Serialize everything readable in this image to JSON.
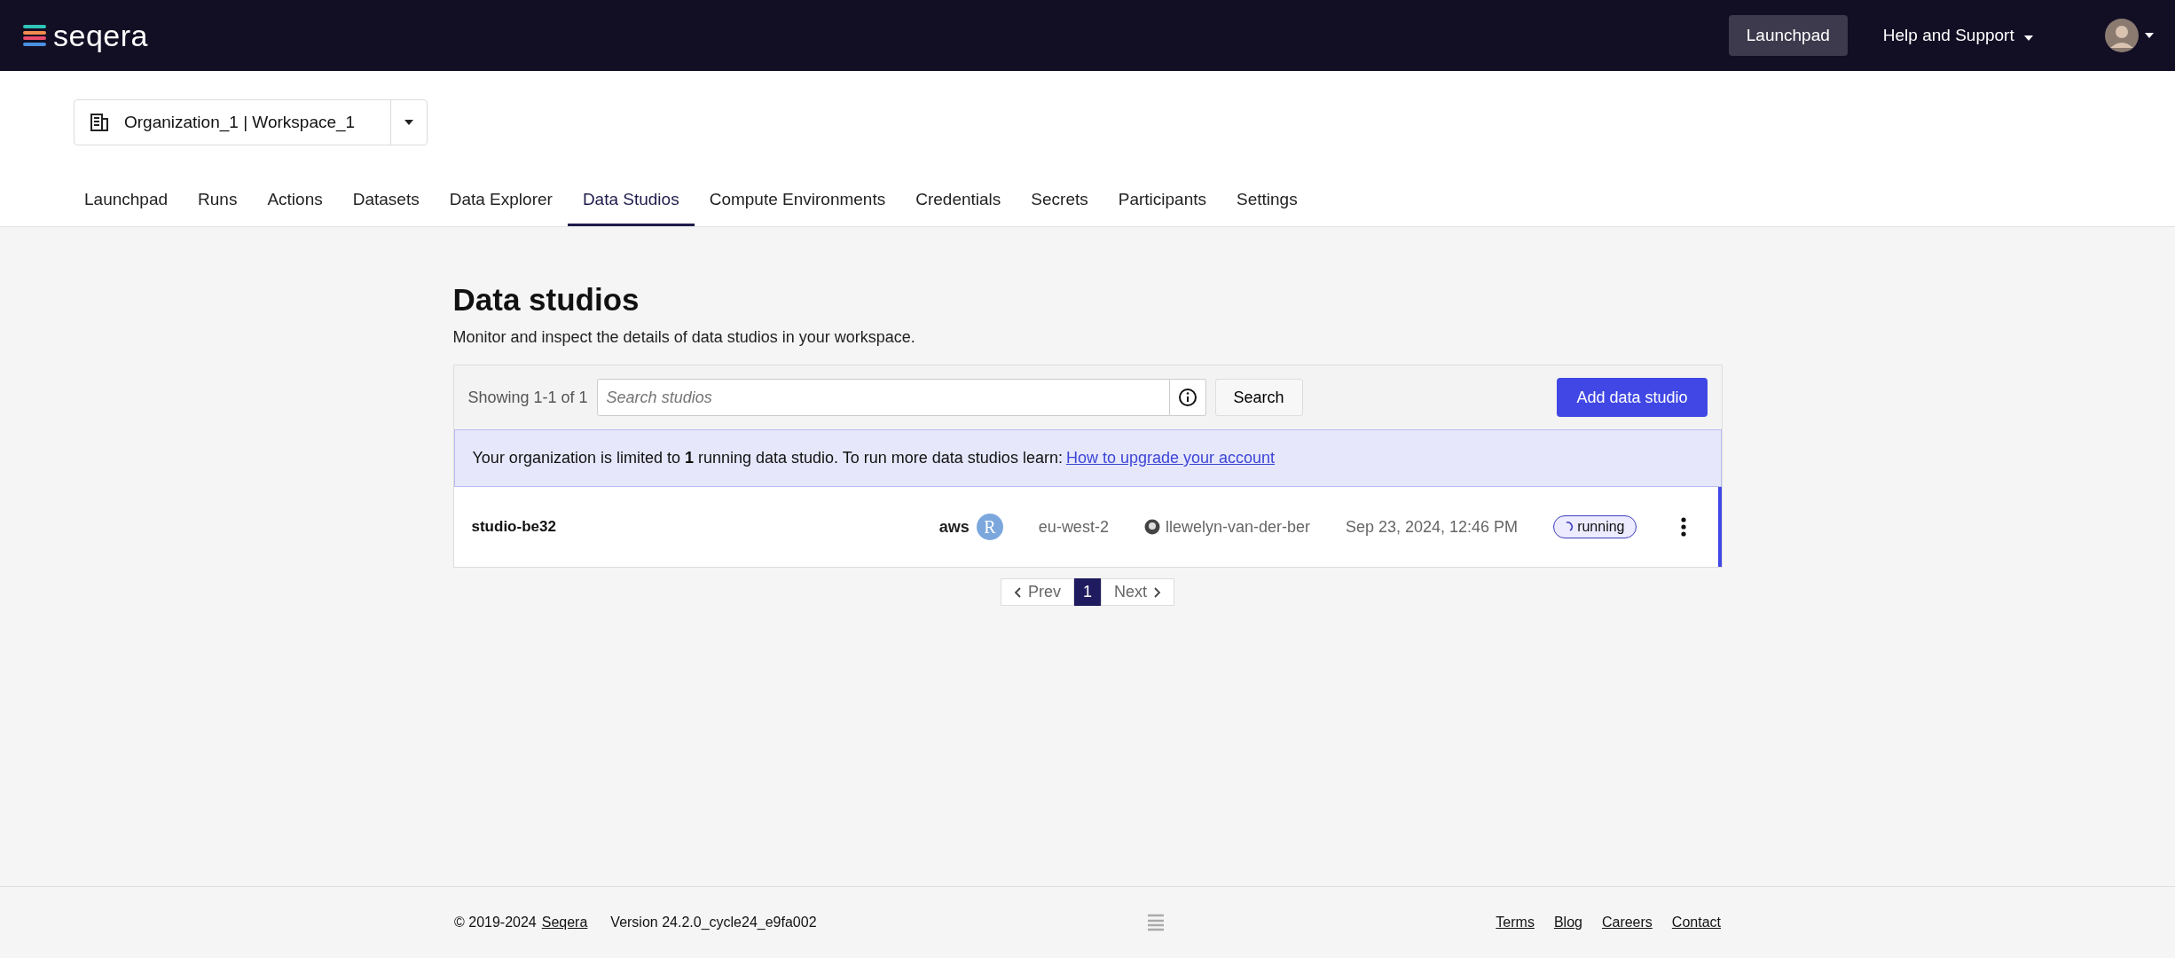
{
  "header": {
    "logo": "seqera",
    "buttons": [
      {
        "label": "Launchpad",
        "kind": "button"
      },
      {
        "label": "Help and Support",
        "kind": "dropdown"
      }
    ]
  },
  "workspace_selector": {
    "value": "Organization_1 | Workspace_1"
  },
  "tabs": [
    {
      "label": "Launchpad",
      "selected": false
    },
    {
      "label": "Runs",
      "selected": false
    },
    {
      "label": "Actions",
      "selected": false
    },
    {
      "label": "Datasets",
      "selected": false
    },
    {
      "label": "Data Explorer",
      "selected": false
    },
    {
      "label": "Data Studios",
      "selected": true
    },
    {
      "label": "Compute Environments",
      "selected": false
    },
    {
      "label": "Credentials",
      "selected": false
    },
    {
      "label": "Secrets",
      "selected": false
    },
    {
      "label": "Participants",
      "selected": false
    },
    {
      "label": "Settings",
      "selected": false
    }
  ],
  "page": {
    "title": "Data studios",
    "subtitle": "Monitor and inspect the details of data studios in your workspace."
  },
  "toolbar": {
    "count": "Showing 1-1 of 1",
    "search": {
      "placeholder": "Search studios"
    },
    "search_button": "Search",
    "add_button": "Add data studio"
  },
  "notice": {
    "text": "Your organization is limited to **1** running data studio. To run more data studios learn:",
    "link": "How to upgrade your account"
  },
  "studios": [
    {
      "name": "studio-be32",
      "cloud": "aws",
      "tool": "R",
      "region": "eu-west-2",
      "user": "llewelyn-van-der-ber",
      "date": "Sep 23, 2024, 12:46 PM",
      "status": "running"
    }
  ],
  "pagination": {
    "prev": "Prev",
    "pages": [
      {
        "label": "1",
        "selected": true
      }
    ],
    "next": "Next"
  },
  "footer": {
    "copyright": "© 2019-2024",
    "company": "Seqera",
    "version": "Version 24.2.0_cycle24_e9fa002",
    "links": [
      "Terms",
      "Blog",
      "Careers",
      "Contact"
    ]
  }
}
